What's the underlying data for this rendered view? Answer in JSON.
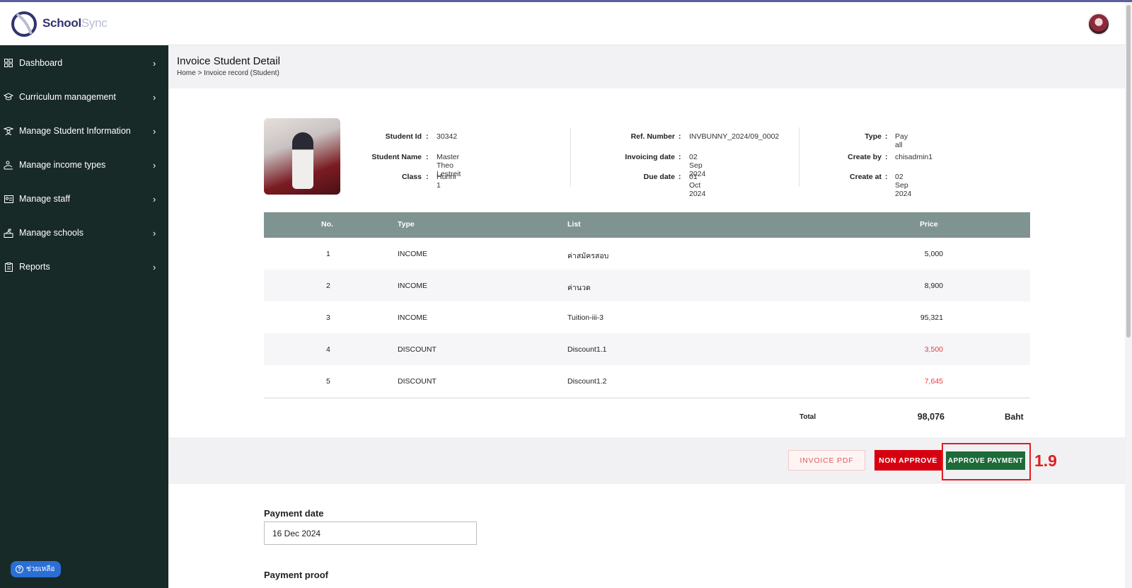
{
  "app": {
    "brand_part1": "School",
    "brand_part2": "Sync"
  },
  "sidebar": {
    "items": [
      {
        "label": "Dashboard",
        "icon": "grid-icon"
      },
      {
        "label": "Curriculum management",
        "icon": "graduation-cap-icon"
      },
      {
        "label": "Manage Student Information",
        "icon": "student-icon"
      },
      {
        "label": "Manage income types",
        "icon": "income-icon"
      },
      {
        "label": "Manage staff",
        "icon": "id-card-icon"
      },
      {
        "label": "Manage schools",
        "icon": "school-icon"
      },
      {
        "label": "Reports",
        "icon": "clipboard-icon"
      }
    ],
    "help_label": "ช่วยเหลือ"
  },
  "header": {
    "title": "Invoice Student Detail",
    "breadcrumb": "Home > Invoice record (Student)"
  },
  "invoice": {
    "student_id_label": "Student Id",
    "student_id": "30342",
    "student_name_label": "Student Name",
    "student_name": "Master Theo Lestreit",
    "class_label": "Class",
    "class": "Hunni 1",
    "ref_label": "Ref. Number",
    "ref": "INVBUNNY_2024/09_0002",
    "invoicing_label": "Invoicing date",
    "invoicing_date": "02 Sep 2024",
    "due_label": "Due date",
    "due_date": "01 Oct 2024",
    "type_label": "Type",
    "type": "Pay all",
    "create_by_label": "Create by",
    "create_by": "chisadmin1",
    "create_at_label": "Create at",
    "create_at": "02 Sep 2024",
    "colon": ":"
  },
  "table": {
    "headers": {
      "no": "No.",
      "type": "Type",
      "list": "List",
      "price": "Price"
    },
    "rows": [
      {
        "no": "1",
        "type": "INCOME",
        "list": "ค่าสมัครสอบ",
        "price": "5,000"
      },
      {
        "no": "2",
        "type": "INCOME",
        "list": "ค่านวด",
        "price": "8,900"
      },
      {
        "no": "3",
        "type": "INCOME",
        "list": "Tuition-iii-3",
        "price": "95,321"
      },
      {
        "no": "4",
        "type": "DISCOUNT",
        "list": "Discount1.1",
        "price": "3,500"
      },
      {
        "no": "5",
        "type": "DISCOUNT",
        "list": "Discount1.2",
        "price": "7,645"
      }
    ],
    "total_label": "Total",
    "total_value": "98,076",
    "total_unit": "Baht",
    "discount_color": "#e04040"
  },
  "actions": {
    "invoice_pdf": "INVOICE PDF",
    "non_approve": "NON APPROVE",
    "approve_payment": "APPROVE PAYMENT",
    "step_label": "1.9"
  },
  "payment": {
    "date_label": "Payment date",
    "date_value": "16 Dec 2024",
    "proof_label": "Payment proof"
  },
  "colors": {
    "sidebar_bg": "#182a28",
    "table_header_bg": "#7f9490",
    "approve_green": "#1e6b3a",
    "non_approve_red": "#d70010",
    "highlight_red": "#e01e1e"
  }
}
